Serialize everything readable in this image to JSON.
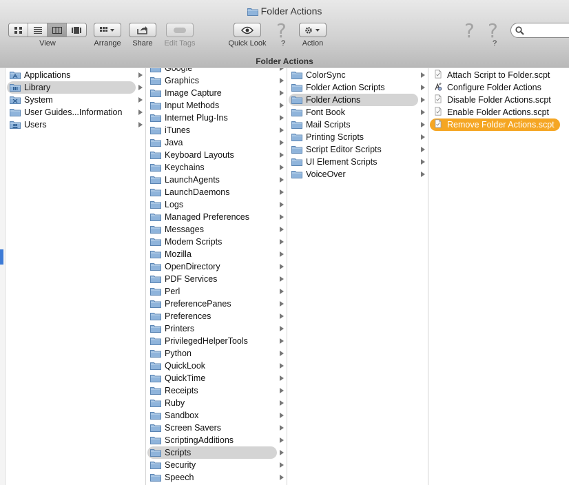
{
  "window": {
    "title": "Folder Actions",
    "path_caption": "Folder Actions"
  },
  "toolbar": {
    "view_label": "View",
    "arrange_label": "Arrange",
    "share_label": "Share",
    "edit_tags_label": "Edit Tags",
    "quick_look_label": "Quick Look",
    "unknown1_label": "?",
    "action_label": "Action",
    "unknown2_label": "?",
    "search_placeholder": ""
  },
  "columns": {
    "col1": [
      {
        "label": "Applications",
        "icon": "applications-folder-icon",
        "arrow": true
      },
      {
        "label": "Library",
        "icon": "library-folder-icon",
        "arrow": true,
        "selected": true
      },
      {
        "label": "System",
        "icon": "system-folder-icon",
        "arrow": true
      },
      {
        "label": "User Guides...Information",
        "icon": "folder-icon",
        "arrow": true
      },
      {
        "label": "Users",
        "icon": "users-folder-icon",
        "arrow": true
      }
    ],
    "col2": [
      {
        "label": "Google",
        "arrow": true
      },
      {
        "label": "Graphics",
        "arrow": true
      },
      {
        "label": "Image Capture",
        "arrow": true
      },
      {
        "label": "Input Methods",
        "arrow": true
      },
      {
        "label": "Internet Plug-Ins",
        "arrow": true
      },
      {
        "label": "iTunes",
        "arrow": true
      },
      {
        "label": "Java",
        "arrow": true
      },
      {
        "label": "Keyboard Layouts",
        "arrow": true
      },
      {
        "label": "Keychains",
        "arrow": true
      },
      {
        "label": "LaunchAgents",
        "arrow": true
      },
      {
        "label": "LaunchDaemons",
        "arrow": true
      },
      {
        "label": "Logs",
        "arrow": true
      },
      {
        "label": "Managed Preferences",
        "arrow": true
      },
      {
        "label": "Messages",
        "arrow": true
      },
      {
        "label": "Modem Scripts",
        "arrow": true
      },
      {
        "label": "Mozilla",
        "arrow": true
      },
      {
        "label": "OpenDirectory",
        "arrow": true
      },
      {
        "label": "PDF Services",
        "arrow": true
      },
      {
        "label": "Perl",
        "arrow": true
      },
      {
        "label": "PreferencePanes",
        "arrow": true
      },
      {
        "label": "Preferences",
        "arrow": true
      },
      {
        "label": "Printers",
        "arrow": true
      },
      {
        "label": "PrivilegedHelperTools",
        "arrow": true
      },
      {
        "label": "Python",
        "arrow": true
      },
      {
        "label": "QuickLook",
        "arrow": true
      },
      {
        "label": "QuickTime",
        "arrow": true
      },
      {
        "label": "Receipts",
        "arrow": true
      },
      {
        "label": "Ruby",
        "arrow": true
      },
      {
        "label": "Sandbox",
        "arrow": true
      },
      {
        "label": "Screen Savers",
        "arrow": true
      },
      {
        "label": "ScriptingAdditions",
        "arrow": true
      },
      {
        "label": "Scripts",
        "arrow": true,
        "selected": true
      },
      {
        "label": "Security",
        "arrow": true
      },
      {
        "label": "Speech",
        "arrow": true
      }
    ],
    "col3": [
      {
        "label": "ColorSync",
        "arrow": true
      },
      {
        "label": "Folder Action Scripts",
        "arrow": true
      },
      {
        "label": "Folder Actions",
        "arrow": true,
        "selected": true
      },
      {
        "label": "Font Book",
        "arrow": true
      },
      {
        "label": "Mail Scripts",
        "arrow": true
      },
      {
        "label": "Printing Scripts",
        "arrow": true
      },
      {
        "label": "Script Editor Scripts",
        "arrow": true
      },
      {
        "label": "UI Element Scripts",
        "arrow": true
      },
      {
        "label": "VoiceOver",
        "arrow": true
      }
    ],
    "col4": [
      {
        "label": "Attach Script to Folder.scpt",
        "icon": "script-file-icon"
      },
      {
        "label": "Configure Folder Actions",
        "icon": "script-app-icon"
      },
      {
        "label": "Disable Folder Actions.scpt",
        "icon": "script-file-icon"
      },
      {
        "label": "Enable Folder Actions.scpt",
        "icon": "script-file-icon"
      },
      {
        "label": "Remove Folder Actions.scpt",
        "icon": "script-file-icon",
        "highlighted": true
      }
    ]
  },
  "colors": {
    "selection_gray": "#d4d4d4",
    "highlight_orange": "#f5a623",
    "folder_blue": "#8fb4db"
  }
}
